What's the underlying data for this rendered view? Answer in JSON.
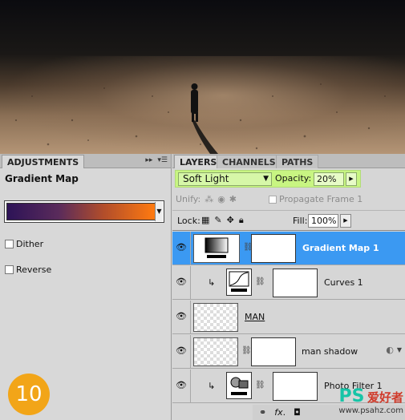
{
  "adjustments": {
    "tab_label": "ADJUSTMENTS",
    "title": "Gradient Map",
    "gradient_colors": [
      "#2d1357",
      "#ff7a10"
    ],
    "dither_label": "Dither",
    "reverse_label": "Reverse"
  },
  "step_number": "10",
  "layers_panel": {
    "tabs": [
      "LAYERS",
      "CHANNELS",
      "PATHS"
    ],
    "blend_mode": "Soft Light",
    "opacity_label": "Opacity:",
    "opacity_value": "20%",
    "unify_label": "Unify:",
    "propagate_label": "Propagate Frame 1",
    "lock_label": "Lock:",
    "fill_label": "Fill:",
    "fill_value": "100%",
    "layers": [
      {
        "name": "Gradient Map 1",
        "selected": true
      },
      {
        "name": "Curves 1",
        "selected": false
      },
      {
        "name": "MAN",
        "selected": false
      },
      {
        "name": "man shadow",
        "selected": false
      },
      {
        "name": "Photo Filter 1",
        "selected": false
      }
    ]
  },
  "watermark": {
    "logo": "PS",
    "chinese": "爱好者",
    "url": "www.psahz.com"
  }
}
